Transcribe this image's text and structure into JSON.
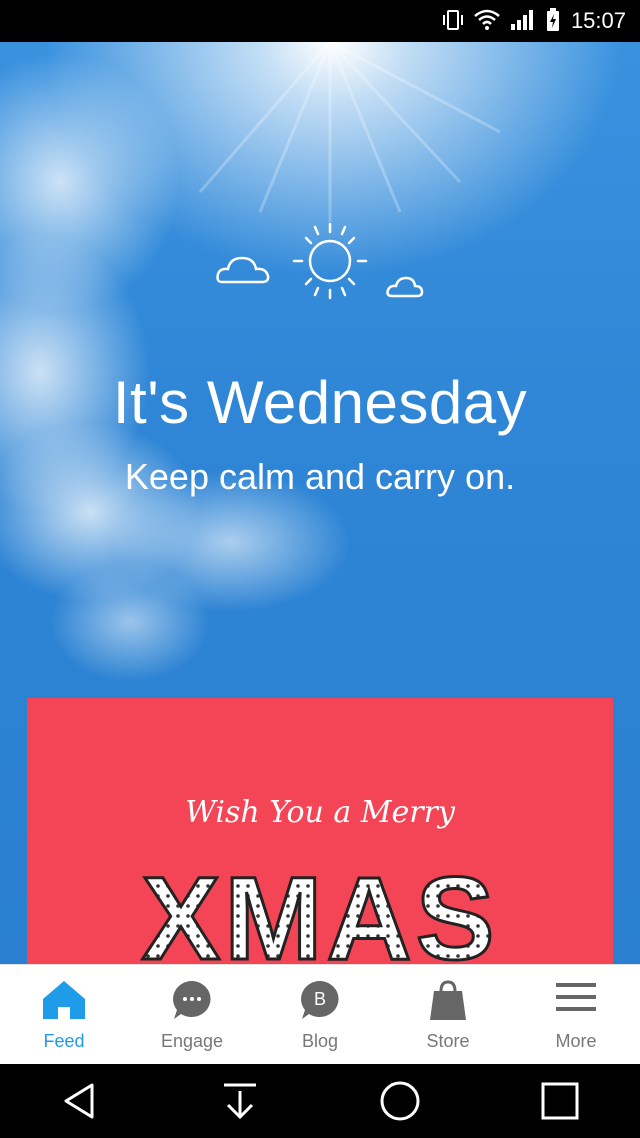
{
  "status": {
    "time": "15:07",
    "icons": [
      "vibrate-icon",
      "wifi-icon",
      "signal-icon",
      "battery-icon"
    ]
  },
  "hero": {
    "title": "It's Wednesday",
    "subtitle": "Keep calm and carry on."
  },
  "card": {
    "script_text": "Wish You a Merry",
    "big_text": "XMAS",
    "bg_color": "#f44556"
  },
  "tabs": [
    {
      "label": "Feed",
      "icon": "home-icon",
      "active": true
    },
    {
      "label": "Engage",
      "icon": "chat-bubble-icon",
      "active": false
    },
    {
      "label": "Blog",
      "icon": "blog-b-icon",
      "badge_letter": "B",
      "active": false
    },
    {
      "label": "Store",
      "icon": "shopping-bag-icon",
      "active": false
    },
    {
      "label": "More",
      "icon": "menu-icon",
      "active": false
    }
  ],
  "accent_color": "#1e9be9",
  "nav": [
    "back-icon",
    "download-icon",
    "home-circle-icon",
    "recents-icon"
  ]
}
